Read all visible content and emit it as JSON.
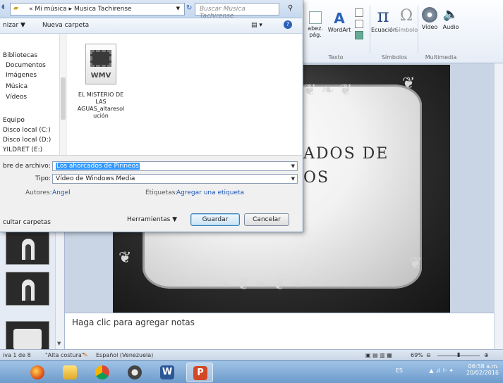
{
  "dialog": {
    "breadcrumb": {
      "prefix": "«",
      "folder": "Mi música",
      "sep": "▸",
      "subfolder": "Musica Tachirense"
    },
    "search_placeholder": "Buscar Musica Tachirense",
    "command_bar": {
      "organize": "nizar ▼",
      "new_folder": "Nueva carpeta"
    },
    "nav_items": [
      "Bibliotecas",
      "Documentos",
      "Imágenes",
      "Música",
      "Vídeos",
      "Equipo",
      "Disco local (C:)",
      "Disco local (D:)",
      "YILDRET (E:)"
    ],
    "file": {
      "type_label": "WMV",
      "name_lines": [
        "EL MISTERIO DE",
        "LAS",
        "AGUAS_altaresol",
        "ución"
      ]
    },
    "filename_label": "bre de archivo:",
    "filename_value": "Los ahorcados de Pirineos",
    "type_label": "Tipo:",
    "type_value": "Vídeo de Windows Media",
    "authors_label": "Autores:",
    "authors_value": "Angel",
    "tags_label": "Etiquetas:",
    "tags_value": "Agregar una etiqueta",
    "hide_folders": "cultar carpetas",
    "tools_button": "Herramientas",
    "save_button": "Guardar",
    "cancel_button": "Cancelar"
  },
  "ribbon": {
    "tabs_partial": "...",
    "group_texto": {
      "header_footer": "abez.",
      "page_no": "pág.",
      "wordart": "WordArt",
      "label": "Texto"
    },
    "group_simbolos": {
      "equation": "Ecuación",
      "symbol": "Símbolo",
      "label": "Símbolos"
    },
    "group_multimedia": {
      "video": "Vídeo",
      "audio": "Audio",
      "label": "Multimedia"
    }
  },
  "slide": {
    "title_line1": "ADOS DE",
    "title_line2": "OS"
  },
  "notes_placeholder": "Haga clic para agregar notas",
  "status": {
    "slide_info": "iva 1 de 8",
    "theme": "\"Alta costura\"",
    "language": "Español (Venezuela)",
    "zoom": "69%"
  },
  "taskbar": {
    "lang": "ES",
    "time": "06:58 a.m.",
    "date": "20/02/2016"
  }
}
